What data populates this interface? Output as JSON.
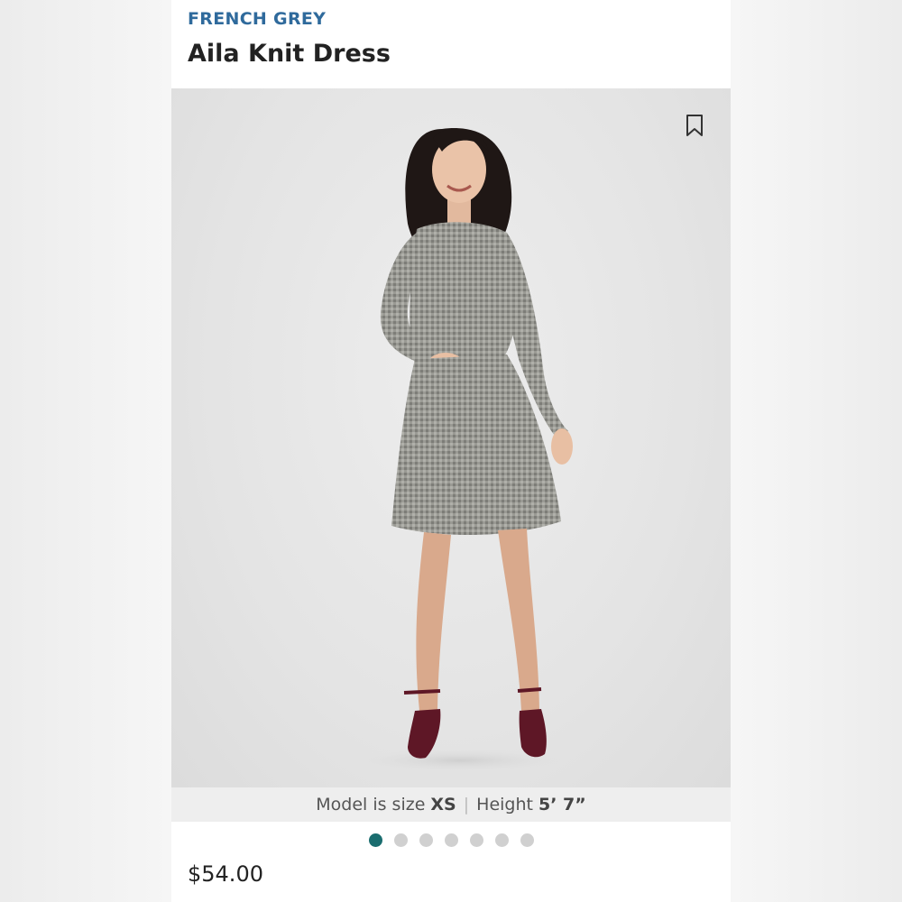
{
  "product": {
    "brand": "FRENCH GREY",
    "name": "Aila Knit Dress",
    "price": "$54.00"
  },
  "model_info": {
    "size_prefix": "Model is size",
    "size": "XS",
    "height_prefix": "Height",
    "height": "5’ 7”"
  },
  "gallery": {
    "image_count": 7,
    "active_index": 0
  },
  "icons": {
    "bookmark": "bookmark-icon"
  },
  "colors": {
    "brand": "#2f6a9c",
    "active_dot": "#1a6d6f"
  }
}
